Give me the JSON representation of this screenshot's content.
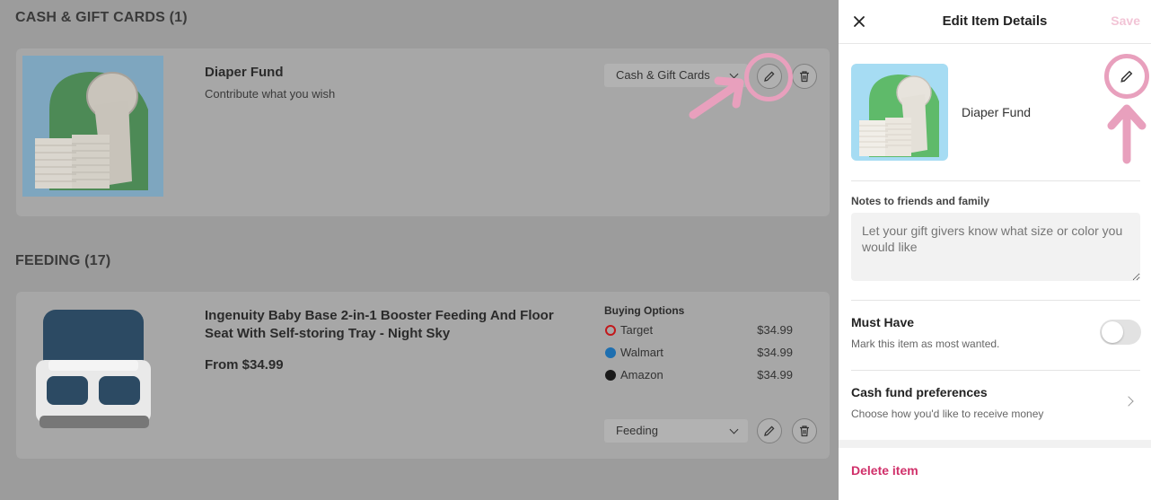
{
  "sections": {
    "cash": {
      "title": "CASH & GIFT CARDS (1)"
    },
    "feeding": {
      "title": "FEEDING (17)"
    }
  },
  "cash_item": {
    "title": "Diaper Fund",
    "subtitle": "Contribute what you wish",
    "category": "Cash & Gift Cards",
    "image": "diaper-stack-icon"
  },
  "feeding_item": {
    "title_line1": "Ingenuity Baby Base 2-in-1 Booster Feeding And Floor",
    "title_line2": "Seat With Self-storing Tray - Night Sky",
    "price": "From $34.99",
    "category": "Feeding",
    "image": "booster-seat-icon",
    "buying_options_label": "Buying Options",
    "stores": [
      {
        "name": "Target",
        "price": "$34.99",
        "icon": "target-logo-icon",
        "color": "#cc0000"
      },
      {
        "name": "Walmart",
        "price": "$34.99",
        "icon": "walmart-logo-icon",
        "color": "#0071ce"
      },
      {
        "name": "Amazon",
        "price": "$34.99",
        "icon": "amazon-logo-icon",
        "color": "#111111"
      }
    ]
  },
  "drawer": {
    "title": "Edit Item Details",
    "save_label": "Save",
    "item_name": "Diaper Fund",
    "notes_label": "Notes to friends and family",
    "notes_placeholder": "Let your gift givers know what size or color you would like",
    "must_have": {
      "title": "Must Have",
      "subtitle": "Mark this item as most wanted.",
      "enabled": false
    },
    "cash_pref": {
      "title": "Cash fund preferences",
      "subtitle": "Choose how you'd like to receive money"
    },
    "delete_label": "Delete item"
  },
  "colors": {
    "accent_pink": "#e8a0bd",
    "delete_red": "#d0306a",
    "save_disabled": "#f2c4d6"
  }
}
